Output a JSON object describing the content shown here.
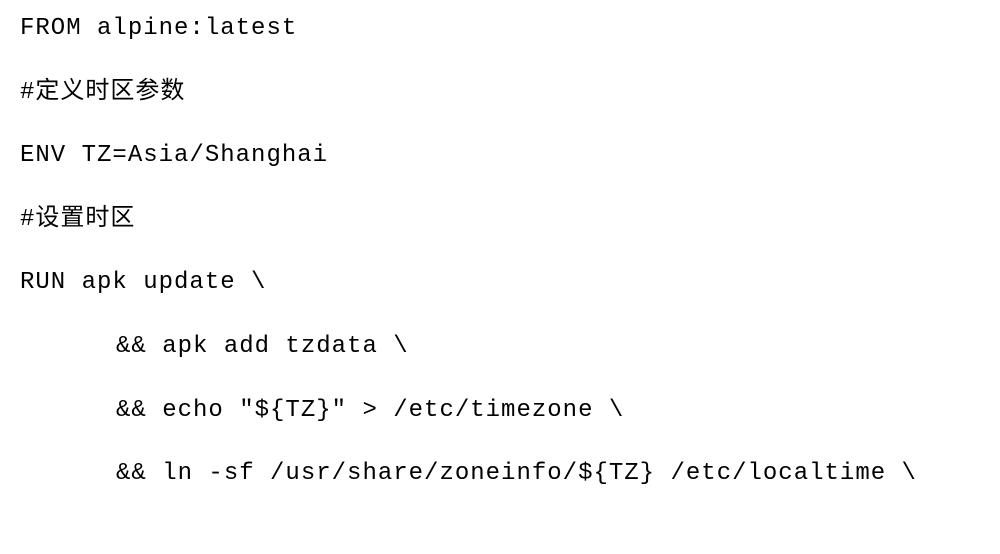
{
  "dockerfile": {
    "line1": "FROM alpine:latest",
    "line2": "#定义时区参数",
    "line3": "ENV TZ=Asia/Shanghai",
    "line4": "#设置时区",
    "line5": "RUN apk update \\",
    "line6": "&& apk add tzdata \\",
    "line7": "&& echo \"${TZ}\" > /etc/timezone \\",
    "line8": "&& ln -sf /usr/share/zoneinfo/${TZ} /etc/localtime \\"
  }
}
